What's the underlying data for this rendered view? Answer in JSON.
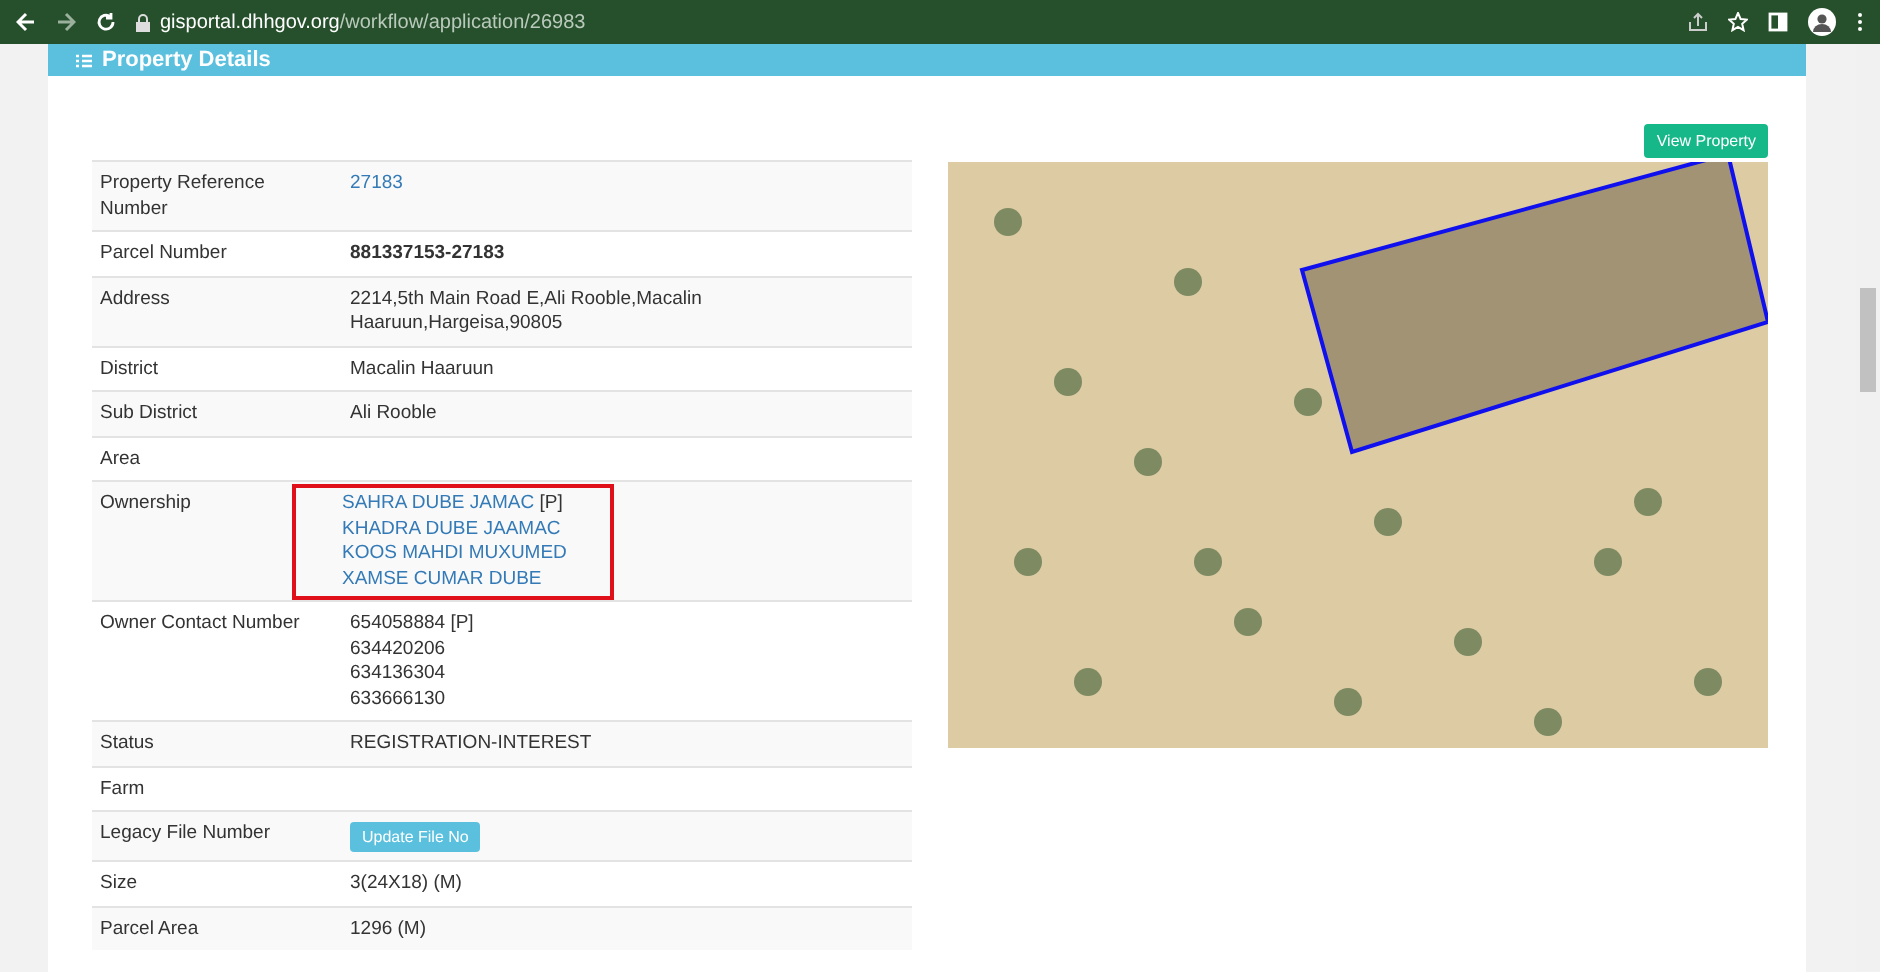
{
  "browser": {
    "url_domain": "gisportal.dhhgov.org",
    "url_path": "/workflow/application/26983"
  },
  "panel": {
    "title": "Property Details"
  },
  "view_button": "View Property",
  "rows": [
    {
      "kind": "link",
      "label": "Property Reference Number",
      "value": "27183"
    },
    {
      "kind": "bold",
      "label": "Parcel Number",
      "value": "881337153-27183"
    },
    {
      "kind": "text",
      "label": "Address",
      "value": "2214,5th Main Road E,Ali Rooble,Macalin Haaruun,Hargeisa,90805"
    },
    {
      "kind": "text",
      "label": "District",
      "value": "Macalin Haaruun"
    },
    {
      "kind": "text",
      "label": "Sub District",
      "value": "Ali Rooble"
    },
    {
      "kind": "text",
      "label": "Area"
    },
    {
      "kind": "owners",
      "label": "Ownership",
      "highlighted": true,
      "owners": [
        {
          "name": "SAHRA DUBE JAMAC",
          "tag": "[P]"
        },
        {
          "name": "KHADRA DUBE JAAMAC"
        },
        {
          "name": "KOOS MAHDI MUXUMED"
        },
        {
          "name": "XAMSE CUMAR DUBE"
        }
      ]
    },
    {
      "kind": "lines",
      "label": "Owner Contact Number",
      "lines": [
        "654058884 [P]",
        "634420206",
        "634136304",
        "633666130"
      ]
    },
    {
      "kind": "text",
      "label": "Status",
      "value": "REGISTRATION-INTEREST"
    },
    {
      "kind": "text",
      "label": "Farm"
    },
    {
      "kind": "button",
      "label": "Legacy File Number",
      "value": "Update File No"
    },
    {
      "kind": "text",
      "label": "Size",
      "value": "3(24X18) (M)"
    },
    {
      "kind": "text",
      "label": "Parcel Area",
      "value": "1296 (M)"
    }
  ]
}
